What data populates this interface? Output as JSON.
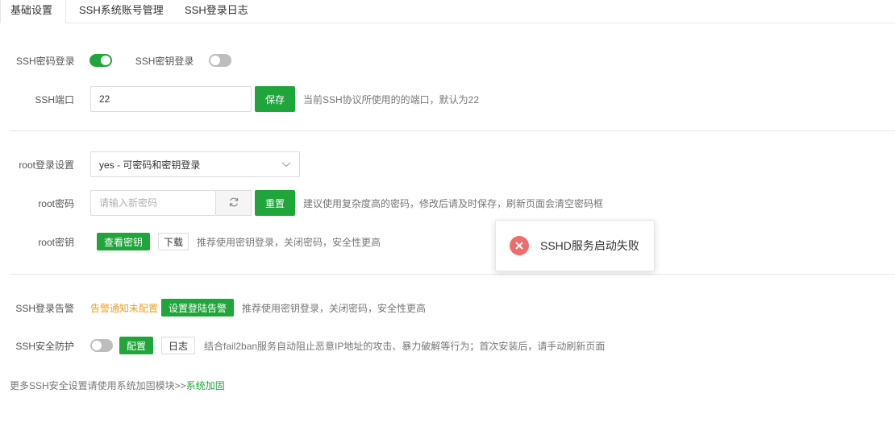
{
  "tabs": [
    {
      "label": "基础设置",
      "active": true
    },
    {
      "label": "SSH系统账号管理",
      "active": false
    },
    {
      "label": "SSH登录日志",
      "active": false
    }
  ],
  "ssh_password_login": {
    "label": "SSH密码登录",
    "enabled": true
  },
  "ssh_key_login": {
    "label": "SSH密钥登录",
    "enabled": false
  },
  "ssh_port": {
    "label": "SSH端口",
    "value": "22",
    "save_label": "保存",
    "hint": "当前SSH协议所使用的的端口，默认为22"
  },
  "root_login": {
    "label": "root登录设置",
    "selected": "yes - 可密码和密钥登录"
  },
  "root_password": {
    "label": "root密码",
    "placeholder": "请输入新密码",
    "reset_label": "重置",
    "hint": "建议使用复杂度高的密码，修改后请及时保存，刷新页面会清空密码框"
  },
  "root_key": {
    "label": "root密钥",
    "view_label": "查看密钥",
    "download_label": "下载",
    "hint": "推荐使用密钥登录，关闭密码，安全性更高"
  },
  "ssh_alarm": {
    "label": "SSH登录告警",
    "status": "告警通知未配置",
    "setup_label": "设置登陆告警",
    "hint": "推荐使用密钥登录，关闭密码，安全性更高"
  },
  "ssh_protect": {
    "label": "SSH安全防护",
    "enabled": false,
    "config_label": "配置",
    "log_label": "日志",
    "hint": "结合fail2ban服务自动阻止恶意IP地址的攻击、暴力破解等行为；首次安装后，请手动刷新页面"
  },
  "footer": {
    "text": "更多SSH安全设置请使用系统加固模块>> ",
    "link": "系统加固"
  },
  "toast": {
    "message": "SSHD服务启动失败",
    "icon": "error-icon"
  },
  "colors": {
    "accent": "#20a53a",
    "warning": "#f0a020",
    "error": "#f06c6c"
  }
}
